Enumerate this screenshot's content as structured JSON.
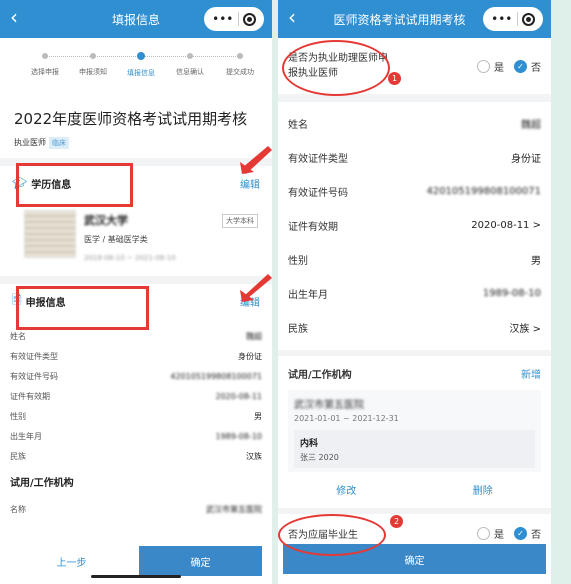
{
  "left": {
    "nav_title": "填报信息",
    "capsule_more": "•••",
    "steps": [
      "选择申报",
      "申报须知",
      "填报信息",
      "信息确认",
      "提交成功"
    ],
    "page_title": "2022年度医师资格考试试用期考核",
    "category": "执业医师",
    "category_tag": "临床",
    "education": {
      "heading": "学历信息",
      "edit": "编辑",
      "school": "武汉大学",
      "degree_tag": "大学本科",
      "major": "医学 / 基础医学类",
      "period": "2018-08-10 ~ 2021-08-10"
    },
    "declaration": {
      "heading": "申报信息",
      "edit": "编辑",
      "rows": [
        {
          "label": "姓名",
          "value": "魏超"
        },
        {
          "label": "有效证件类型",
          "value": "身份证"
        },
        {
          "label": "有效证件号码",
          "value": "420105199808100071"
        },
        {
          "label": "证件有效期",
          "value": "2020-08-11"
        },
        {
          "label": "性别",
          "value": "男"
        },
        {
          "label": "出生年月",
          "value": "1989-08-10"
        },
        {
          "label": "民族",
          "value": "汉族"
        }
      ]
    },
    "trial": {
      "heading": "试用/工作机构",
      "name_label": "名称",
      "name_value": "武汉市第五医院"
    },
    "btn_prev": "上一步",
    "btn_ok": "确定"
  },
  "right": {
    "nav_title": "医师资格考试试用期考核",
    "capsule_more": "•••",
    "assistant_question": "是否为执业助理医师申报执业医师",
    "yes": "是",
    "no": "否",
    "rows": [
      {
        "label": "姓名",
        "value": "魏超",
        "chevron": ""
      },
      {
        "label": "有效证件类型",
        "value": "身份证",
        "chevron": ""
      },
      {
        "label": "有效证件号码",
        "value": "420105199808100071",
        "chevron": ""
      },
      {
        "label": "证件有效期",
        "value": "2020-08-11",
        "chevron": ">"
      },
      {
        "label": "性别",
        "value": "男",
        "chevron": ""
      },
      {
        "label": "出生年月",
        "value": "1989-08-10",
        "chevron": ""
      },
      {
        "label": "民族",
        "value": "汉族",
        "chevron": ">"
      }
    ],
    "trial": {
      "heading": "试用/工作机构",
      "add": "新增",
      "org": "武汉市第五医院",
      "org_period": "2021-01-01 ~ 2021-12-31",
      "dept": "内科",
      "dept_detail": "张三  2020",
      "modify": "修改",
      "delete": "删除"
    },
    "graduate_question": "否为应届毕业生",
    "btn_ok": "确定",
    "badges": [
      "1",
      "2"
    ]
  },
  "colors": {
    "accent": "#2f8fd1",
    "annotation": "#e53935",
    "frame_bg": "#dff0ea"
  }
}
